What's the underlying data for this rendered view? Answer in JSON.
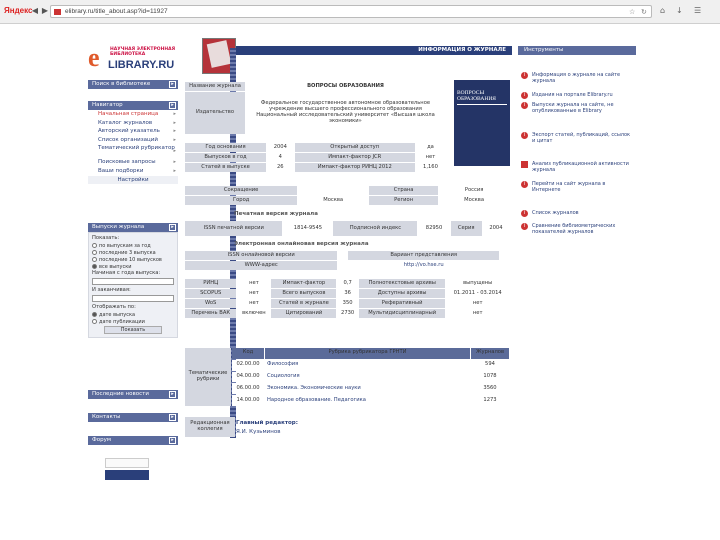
{
  "browser": {
    "logo": "Яндекс",
    "url": "elibrary.ru/title_about.asp?id=11927"
  },
  "logo": {
    "top": "НАУЧНАЯ ЭЛЕКТРОННАЯ БИБЛИОТЕКА",
    "name": "LIBRARY.RU"
  },
  "sidebar": {
    "search_btn": "Поиск в библиотеке",
    "nav_head": "Навигатор",
    "nav_items": [
      "Начальная страница",
      "Каталог журналов",
      "Авторский указатель",
      "Список организаций",
      "Тематический рубрикатор",
      "Поисковые запросы",
      "Ваши подборки"
    ],
    "settings": "Настройки",
    "issues_head": "Выпуски журнала",
    "show_label": "Показать:",
    "radios": [
      "по выпускам за год",
      "последние 3 выпуска",
      "последние 10 выпусков",
      "все выпуски"
    ],
    "year_from": "Начиная с года выпуска:",
    "year_to": "И заканчивая:",
    "sort_label": "Отображать по:",
    "sort": [
      "дате выпуска",
      "дате публикации"
    ],
    "show_btn": "Показать",
    "news": "Последние новости",
    "contacts": "Контакты",
    "forum": "Форум"
  },
  "center": {
    "head": "ИНФОРМАЦИЯ О ЖУРНАЛЕ",
    "rows": [
      {
        "label": "Название журнала",
        "value": "ВОПРОСЫ ОБРАЗОВАНИЯ"
      },
      {
        "label": "Издательство",
        "value": "Федеральное государственное автономное образовательное учреждение высшего профессионального образования Национальный исследовательский университет «Высшая школа экономики»"
      }
    ],
    "stats": [
      [
        "Год основания",
        "2004",
        "Открытый доступ",
        "да"
      ],
      [
        "Выпусков в год",
        "4",
        "Импакт-фактор JCR",
        "нет"
      ],
      [
        "Статей в выпуске",
        "26",
        "Импакт-фактор РИНЦ 2012",
        "1,160"
      ]
    ],
    "geo": [
      [
        "Сокращение",
        "",
        "Страна",
        "Россия"
      ],
      [
        "Город",
        "Москва",
        "Регион",
        "Москва"
      ]
    ],
    "print_title": "Печатная версия журнала",
    "print_row": [
      "ISSN печатной версии",
      "1814-9545",
      "Подписной индекс",
      "82950",
      "Серия",
      "2004"
    ],
    "online_title": "Электронная онлайновая версия журнала",
    "online_rows": [
      [
        "ISSN онлайновой версии",
        "",
        "Вариант представления",
        ""
      ],
      [
        "WWW-адрес",
        "",
        "http://vo.hse.ru",
        ""
      ]
    ],
    "db": [
      [
        "РИНЦ",
        "нет",
        "Импакт-фактор",
        "0,7",
        "Полнотекстовые архивы",
        "выпущены"
      ],
      [
        "SCOPUS",
        "нет",
        "Всего выпусков",
        "36",
        "Доступны архивы",
        "01.2011 - 03.2014"
      ],
      [
        "WoS",
        "нет",
        "Статей в журнале",
        "350",
        "Реферативный",
        "нет"
      ],
      [
        "Перечень ВАК",
        "включен",
        "Цитирований",
        "2730",
        "Мультидисциплинарный",
        "нет"
      ]
    ],
    "rub_label": "Тематические рубрики",
    "rub_head": [
      "Код",
      "Рубрика рубрикатора ГРНТИ",
      "Журналов"
    ],
    "rubrics": [
      [
        "02.00.00",
        "Философия",
        "594"
      ],
      [
        "04.00.00",
        "Социология",
        "1078"
      ],
      [
        "06.00.00",
        "Экономика. Экономические науки",
        "3560"
      ],
      [
        "14.00.00",
        "Народное образование. Педагогика",
        "1273"
      ]
    ],
    "editor_label": "Редакционная коллегия",
    "editor_title": "Главный редактор:",
    "editor_name": "Я.И. Кузьминов"
  },
  "cover": {
    "title": "ВОПРОСЫ ОБРАЗОВАНИЯ"
  },
  "right": {
    "head": "Инструменты",
    "items": [
      "Информация о журнале на сайте журнала",
      "Издания на портале Elibrary.ru",
      "Выпуски журнала на сайте, не опубликованные в Elibrary",
      "Экспорт статей, публикаций, ссылок и цитат",
      "Анализ публикационной активности журнала",
      "Перейти на сайт журнала в Интернете",
      "Список журналов",
      "Сравнение библиометрических показателей журналов"
    ]
  },
  "colors": {
    "nav_blue": "#2a3f7a",
    "accent_red": "#c33",
    "header_blue": "#5a6a9c"
  }
}
